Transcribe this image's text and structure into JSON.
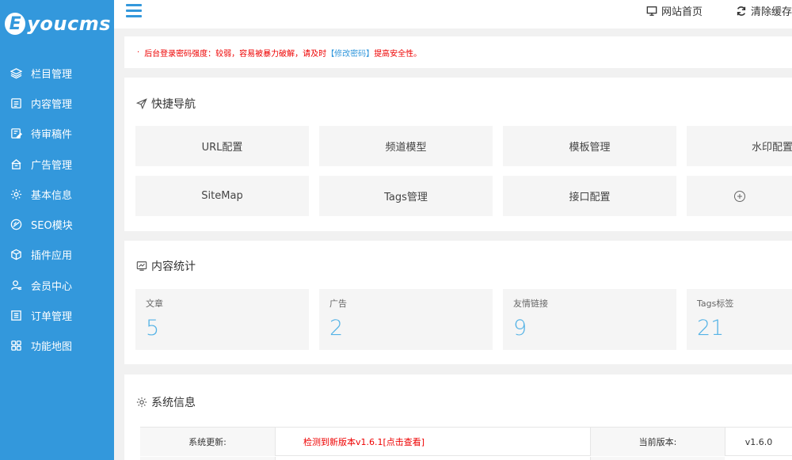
{
  "brand": {
    "logo_letter": "E",
    "logo_text": "youcms",
    "primary_color": "#3398dc"
  },
  "sidebar": {
    "items": [
      {
        "label": "栏目管理",
        "icon": "layers-icon"
      },
      {
        "label": "内容管理",
        "icon": "document-icon"
      },
      {
        "label": "待审稿件",
        "icon": "edit-document-icon"
      },
      {
        "label": "广告管理",
        "icon": "ad-icon"
      },
      {
        "label": "基本信息",
        "icon": "gear-icon"
      },
      {
        "label": "SEO模块",
        "icon": "seo-icon"
      },
      {
        "label": "插件应用",
        "icon": "cube-icon"
      },
      {
        "label": "会员中心",
        "icon": "user-icon"
      },
      {
        "label": "订单管理",
        "icon": "order-icon"
      },
      {
        "label": "功能地图",
        "icon": "grid-icon"
      }
    ]
  },
  "header": {
    "site_home": "网站首页",
    "clear_cache": "清除缓存"
  },
  "notice": {
    "prefix": "后台登录密码强度：较弱，容易被暴力破解，请及时",
    "link": "【修改密码】",
    "suffix": "提高安全性。"
  },
  "quick_nav": {
    "title": "快捷导航",
    "buttons": [
      "URL配置",
      "频道模型",
      "模板管理",
      "水印配置",
      "SiteMap",
      "Tags管理",
      "接口配置",
      "+"
    ]
  },
  "stats": {
    "title": "内容统计",
    "items": [
      {
        "label": "文章",
        "value": "5"
      },
      {
        "label": "广告",
        "value": "2"
      },
      {
        "label": "友情链接",
        "value": "9"
      },
      {
        "label": "Tags标签",
        "value": "21"
      }
    ]
  },
  "sysinfo": {
    "title": "系统信息",
    "update_label": "系统更新:",
    "update_value": "检测到新版本v1.6.1[点击查看]",
    "version_label": "当前版本:",
    "version_value": "v1.6.0"
  }
}
